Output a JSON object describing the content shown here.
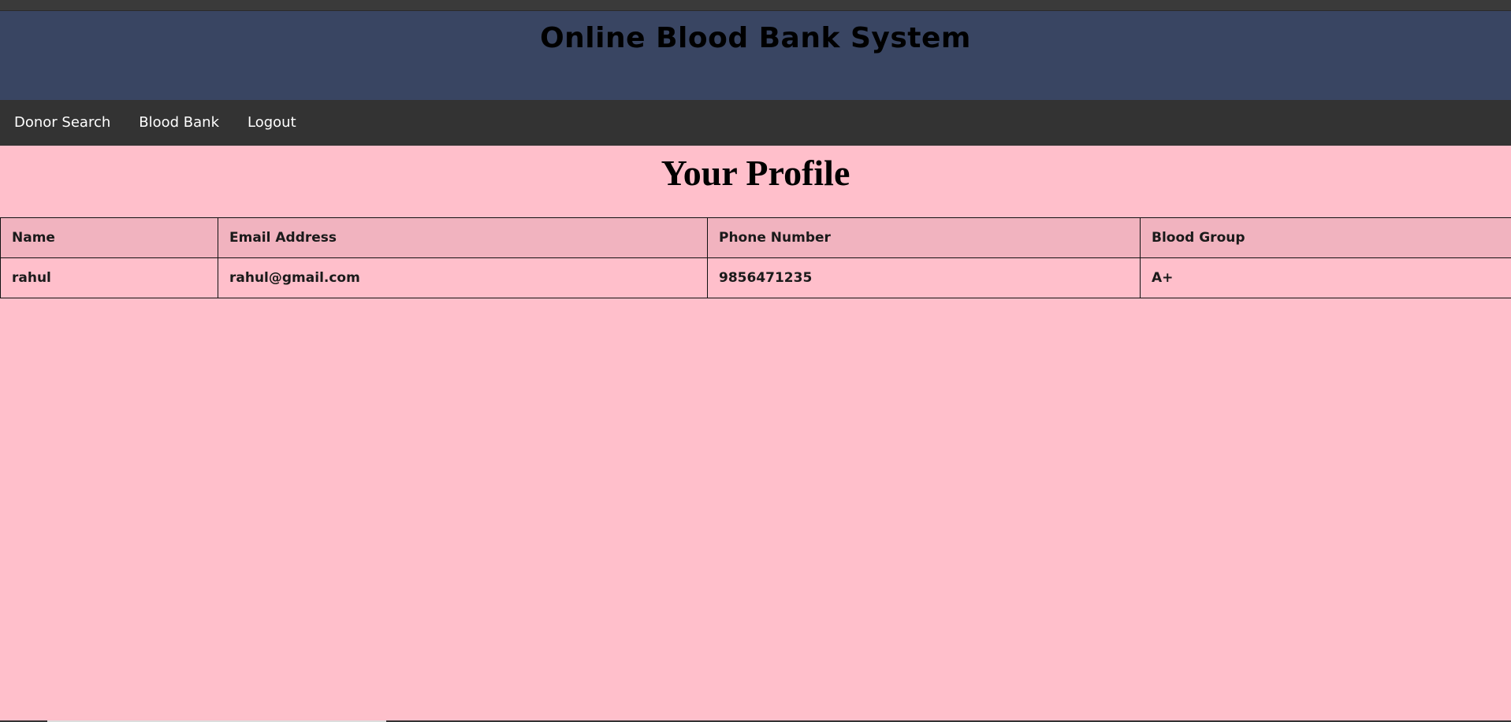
{
  "header": {
    "site_title": "Online Blood Bank System"
  },
  "nav": {
    "items": [
      {
        "label": "Donor Search"
      },
      {
        "label": "Blood Bank"
      },
      {
        "label": "Logout"
      }
    ]
  },
  "main": {
    "page_title": "Your Profile",
    "table": {
      "columns": [
        "Name",
        "Email Address",
        "Phone Number",
        "Blood Group"
      ],
      "rows": [
        [
          "rahul",
          "rahul@gmail.com",
          "9856471235",
          "A+"
        ]
      ]
    }
  },
  "colors": {
    "header_bg": "#394562",
    "nav_bg": "#333333",
    "page_bg": "#ffbfcb",
    "table_header_bg": "#f1b3bf"
  }
}
